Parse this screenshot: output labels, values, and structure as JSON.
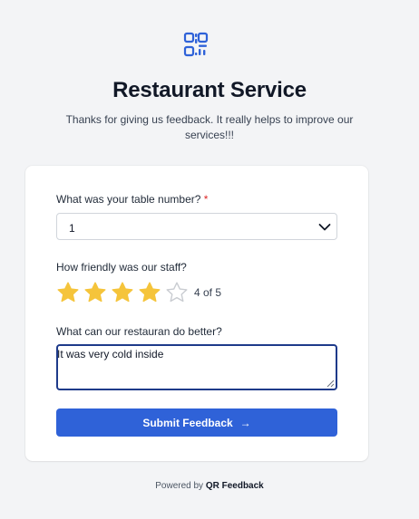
{
  "header": {
    "logo_icon": "qr-code-icon",
    "title": "Restaurant Service",
    "subtitle": "Thanks for giving us feedback. It really helps to improve our services!!!"
  },
  "form": {
    "table_label": "What was your table number?",
    "required_mark": "*",
    "table_value": "1",
    "staff_label": "How friendly was our staff?",
    "rating": {
      "value": 4,
      "max": 5,
      "text": "4 of 5"
    },
    "improve_label": "What can our restauran do better?",
    "improve_value": "It was very cold inside",
    "submit_label": "Submit Feedback",
    "submit_icon": "arrow-right-icon"
  },
  "footer": {
    "prefix": "Powered by",
    "brand": "QR Feedback"
  },
  "colors": {
    "accent": "#2f62d8",
    "star_filled": "#f5c43b",
    "star_empty": "#c9ccd1",
    "required": "#dc2626"
  }
}
